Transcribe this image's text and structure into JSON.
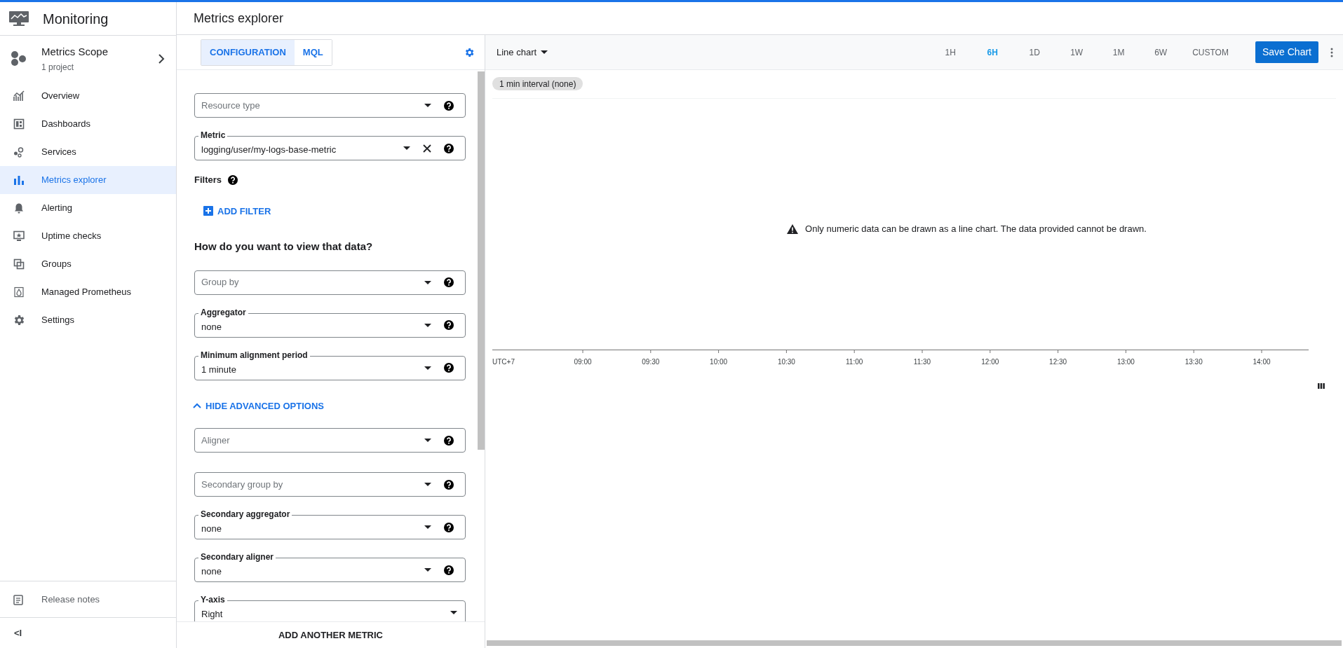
{
  "app": {
    "title": "Monitoring"
  },
  "scope": {
    "title": "Metrics Scope",
    "subtitle": "1 project"
  },
  "nav": [
    {
      "label": "Overview",
      "selected": false
    },
    {
      "label": "Dashboards",
      "selected": false
    },
    {
      "label": "Services",
      "selected": false
    },
    {
      "label": "Metrics explorer",
      "selected": true
    },
    {
      "label": "Alerting",
      "selected": false
    },
    {
      "label": "Uptime checks",
      "selected": false
    },
    {
      "label": "Groups",
      "selected": false
    },
    {
      "label": "Managed Prometheus",
      "selected": false
    },
    {
      "label": "Settings",
      "selected": false
    }
  ],
  "footer": {
    "release_notes": "Release notes",
    "collapse": "<I"
  },
  "page_title": "Metrics explorer",
  "editor": {
    "tabs": [
      {
        "label": "CONFIGURATION",
        "selected": true
      },
      {
        "label": "MQL",
        "selected": false
      }
    ],
    "fields_top": [
      {
        "placeholder": "Resource type",
        "help": true,
        "clearable": false
      },
      {
        "label": "Metric",
        "value": "logging/user/my-logs-base-metric",
        "help": true,
        "clearable": true
      }
    ],
    "filters": "Filters",
    "add_filter": "ADD FILTER",
    "heading": "How do you want to view that data?",
    "fields_view": [
      {
        "placeholder": "Group by",
        "help": true,
        "clearable": false
      },
      {
        "label": "Aggregator",
        "value": "none",
        "help": true,
        "clearable": false
      },
      {
        "label": "Minimum alignment period",
        "value": "1 minute",
        "help": true,
        "clearable": false
      }
    ],
    "advanced_toggle": {
      "label": "HIDE ADVANCED OPTIONS",
      "expanded": true
    },
    "fields_advanced": [
      {
        "placeholder": "Aligner",
        "help": true,
        "clearable": false
      },
      {
        "placeholder": "Secondary group by",
        "help": true,
        "clearable": false
      },
      {
        "label": "Secondary aggregator",
        "value": "none",
        "help": true,
        "clearable": false
      },
      {
        "label": "Secondary aligner",
        "value": "none",
        "help": true,
        "clearable": false
      },
      {
        "label": "Y-axis",
        "value": "Right",
        "help": false,
        "clearable": false
      }
    ],
    "add_metric": "ADD ANOTHER METRIC"
  },
  "chart": {
    "type": "Line chart",
    "ranges": [
      {
        "label": "1H",
        "selected": false
      },
      {
        "label": "6H",
        "selected": true
      },
      {
        "label": "1D",
        "selected": false
      },
      {
        "label": "1W",
        "selected": false
      },
      {
        "label": "1M",
        "selected": false
      },
      {
        "label": "6W",
        "selected": false
      },
      {
        "label": "CUSTOM",
        "selected": false
      }
    ],
    "save": "Save Chart",
    "chip": "1 min interval (none)",
    "message": "Only numeric data can be drawn as a line chart. The data provided cannot be drawn.",
    "timezone": "UTC+7",
    "ticks": [
      "09:00",
      "09:30",
      "10:00",
      "10:30",
      "11:00",
      "11:30",
      "12:00",
      "12:30",
      "13:00",
      "13:30",
      "14:00"
    ]
  }
}
